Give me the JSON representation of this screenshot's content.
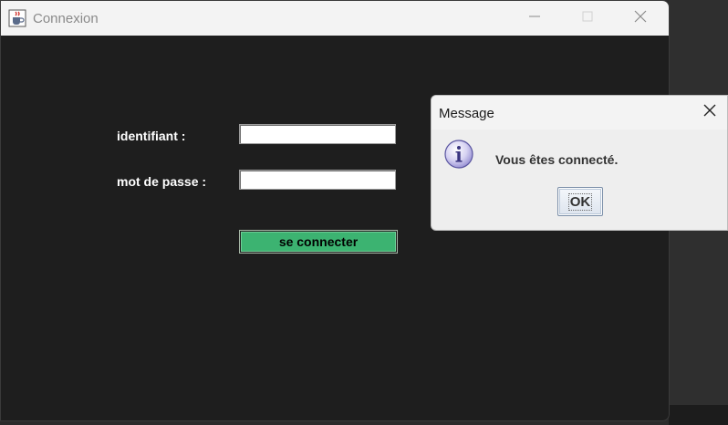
{
  "main_window": {
    "title": "Connexion",
    "app_icon": "java-coffee-cup-icon",
    "controls": {
      "minimize_icon": "minimize-icon",
      "maximize_icon": "maximize-icon",
      "close_icon": "close-icon"
    }
  },
  "login_form": {
    "username_label": "identifiant :",
    "username_value": "",
    "password_label": "mot de passe :",
    "password_value": "",
    "connect_button": "se connecter",
    "connect_button_color": "#3cb371",
    "background_color": "#1e1e1e"
  },
  "message_dialog": {
    "title": "Message",
    "icon": "information-icon",
    "message": "Vous êtes connecté.",
    "ok_button": "OK",
    "close_icon": "close-icon"
  }
}
